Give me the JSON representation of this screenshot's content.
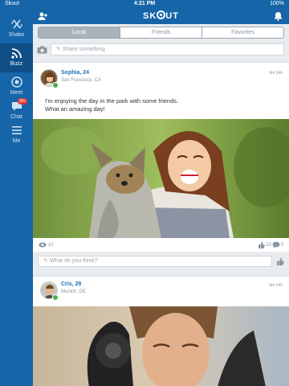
{
  "status_bar": {
    "carrier": "Skout",
    "time": "4:21 PM",
    "battery": "100%"
  },
  "sidebar": {
    "items": [
      {
        "label": "Shake",
        "icon": "shake-icon",
        "active": false
      },
      {
        "label": "Buzz",
        "icon": "rss-icon",
        "active": true
      },
      {
        "label": "Meet",
        "icon": "target-icon",
        "active": false
      },
      {
        "label": "Chat",
        "icon": "chat-icon",
        "active": false,
        "badge": "99+"
      },
      {
        "label": "Me",
        "icon": "menu-icon",
        "active": false
      }
    ]
  },
  "header": {
    "logo_left": "SK",
    "logo_right": "UT",
    "left_icon": "add-user-icon",
    "right_icon": "bell-icon"
  },
  "tabs": [
    {
      "label": "Local",
      "active": true
    },
    {
      "label": "Friends",
      "active": false
    },
    {
      "label": "Favorites",
      "active": false
    }
  ],
  "share": {
    "placeholder": "Share something"
  },
  "posts": [
    {
      "name": "Sophia, 24",
      "location": "San Francisco, CA",
      "meta": "9m 14h",
      "text_line1": "I'm enjoying the day in the park with some friends.",
      "text_line2": "What an amazing day!",
      "views": "10",
      "likes": "10",
      "comments": "0",
      "comment_placeholder": "What do you think?"
    },
    {
      "name": "Cris, 28",
      "location": "Munich, DE",
      "meta": "9m 14h"
    }
  ],
  "colors": {
    "brand": "#1565a8",
    "name_link": "#1e6fb4"
  }
}
